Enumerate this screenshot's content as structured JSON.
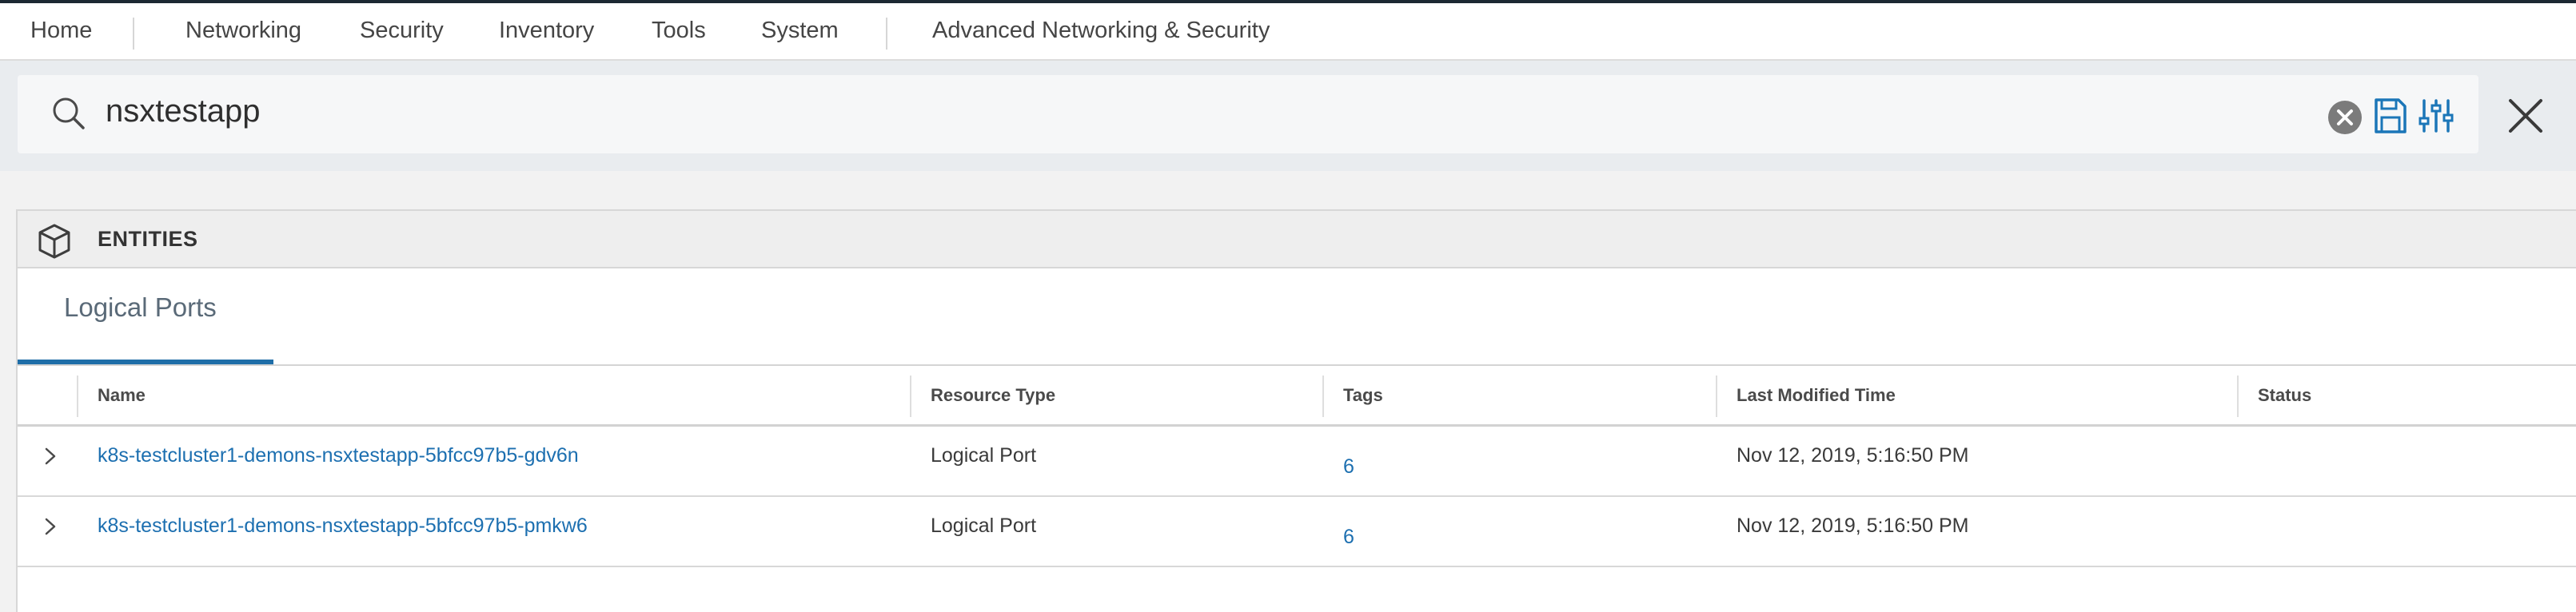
{
  "nav": {
    "items": [
      "Home",
      "Networking",
      "Security",
      "Inventory",
      "Tools",
      "System",
      "Advanced Networking & Security"
    ]
  },
  "search": {
    "query": "nsxtestapp"
  },
  "panel": {
    "title": "ENTITIES",
    "tab": "Logical Ports"
  },
  "table": {
    "columns": [
      "Name",
      "Resource Type",
      "Tags",
      "Last Modified Time",
      "Status"
    ],
    "rows": [
      {
        "name": "k8s-testcluster1-demons-nsxtestapp-5bfcc97b5-gdv6n",
        "resource_type": "Logical Port",
        "tags": "6",
        "last_modified": "Nov 12, 2019, 5:16:50 PM",
        "status": ""
      },
      {
        "name": "k8s-testcluster1-demons-nsxtestapp-5bfcc97b5-pmkw6",
        "resource_type": "Logical Port",
        "tags": "6",
        "last_modified": "Nov 12, 2019, 5:16:50 PM",
        "status": ""
      }
    ]
  },
  "colors": {
    "accent": "#1f6ea8",
    "link": "#1c6fb0",
    "icon_blue": "#1b76b8"
  },
  "icons": {
    "search": "magnifier",
    "clear": "circle-x",
    "save": "floppy-disk",
    "filter": "sliders",
    "close": "x",
    "entities": "cube",
    "expand": "chevron-right"
  }
}
